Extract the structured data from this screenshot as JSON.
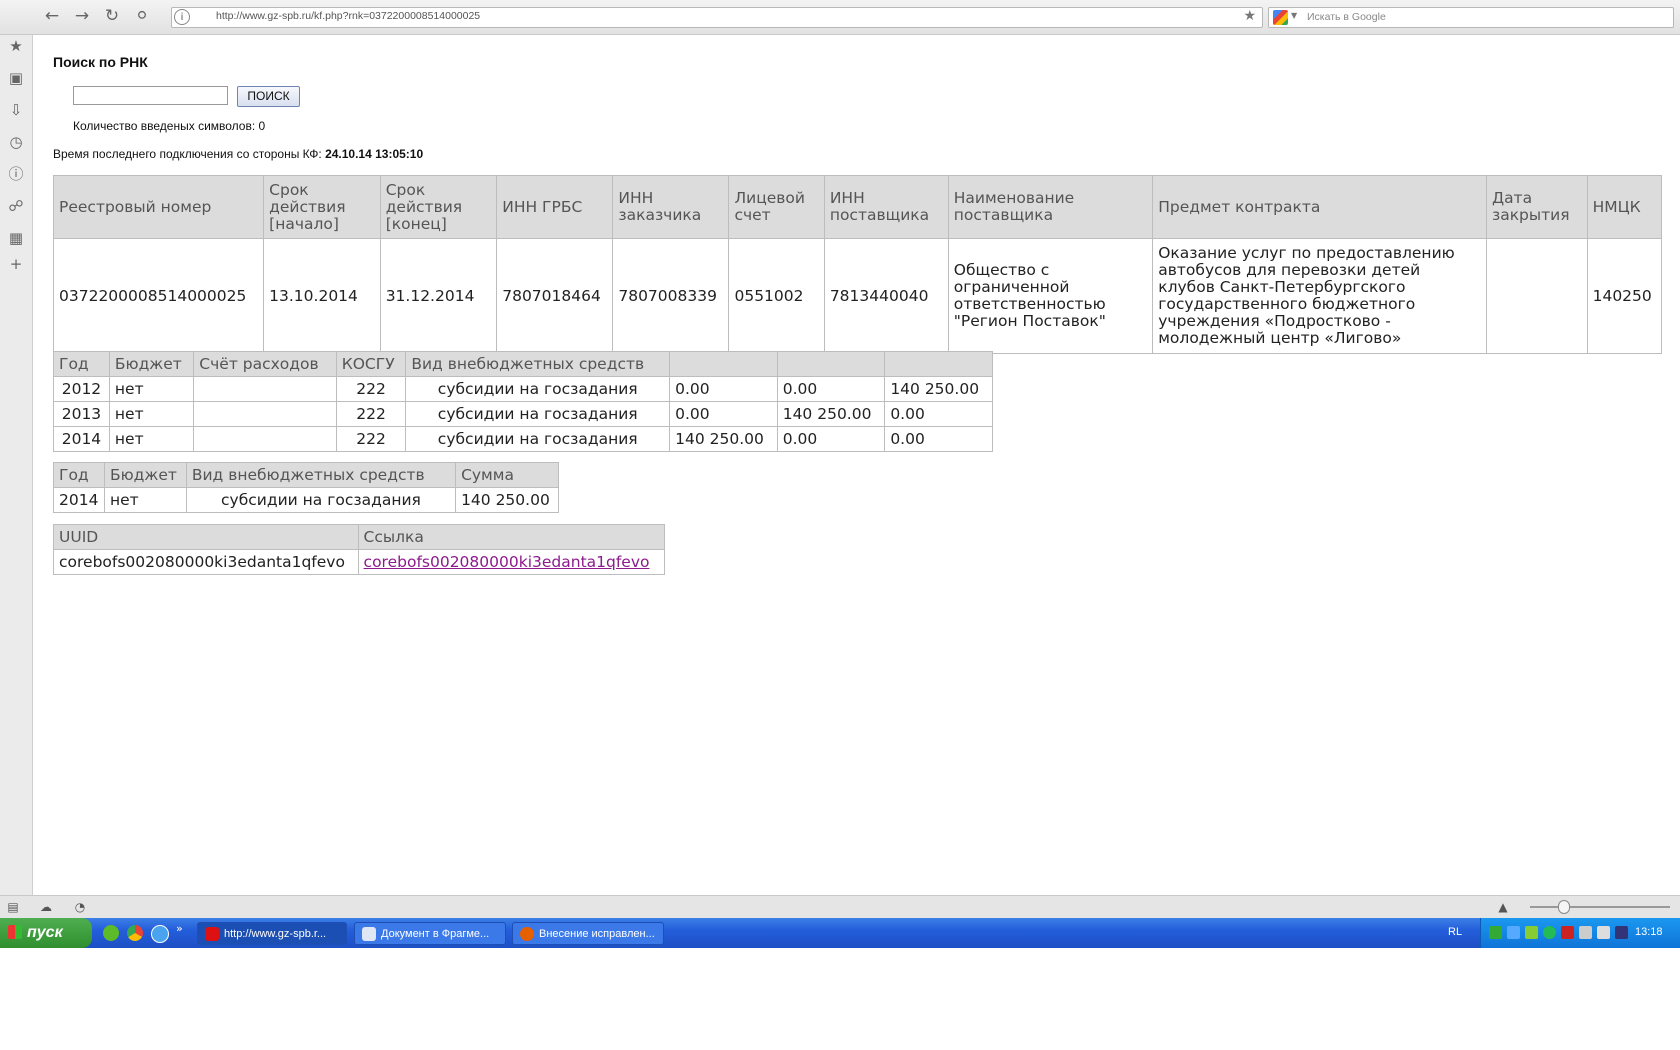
{
  "browser": {
    "address": "http://www.gz-spb.ru/kf.php?rnk=0372200008514000025",
    "search_placeholder": "Искать в Google"
  },
  "page": {
    "title": "Поиск по РНК",
    "search_input_value": "",
    "search_button": "ПОИСК",
    "char_count_label": "Количество введеных символов:",
    "char_count_value": "0",
    "last_connection_label": "Время последнего подключения со стороны КФ:",
    "last_connection_value": "24.10.14 13:05:10"
  },
  "main_table": {
    "headers": [
      "Реестровый номер",
      "Срок действия [начало]",
      "Срок действия [конец]",
      "ИНН ГРБС",
      "ИНН заказчика",
      "Лицевой счет",
      "ИНН поставщика",
      "Наименование поставщика",
      "Предмет контракта",
      "Дата закрытия",
      "НМЦК"
    ],
    "row": [
      "0372200008514000025",
      "13.10.2014",
      "31.12.2014",
      "7807018464",
      "7807008339",
      "0551002",
      "7813440040",
      "Общество с ограниченной ответственностью \"Регион Поставок\"",
      "Оказание услуг по предоставлению автобусов для перевозки детей клубов Санкт-Петербургского государственного бюджетного учреждения «Подростково - молодежный центр «Лигово»",
      "",
      "140250"
    ]
  },
  "finance_table": {
    "headers": [
      "Год",
      "Бюджет",
      "Счёт расходов",
      "КОСГУ",
      "Вид внебюджетных средств",
      "",
      "",
      ""
    ],
    "rows": [
      [
        "2012",
        "нет",
        "",
        "222",
        "субсидии на госзадания",
        "0.00",
        "0.00",
        "140 250.00"
      ],
      [
        "2013",
        "нет",
        "",
        "222",
        "субсидии на госзадания",
        "0.00",
        "140 250.00",
        "0.00"
      ],
      [
        "2014",
        "нет",
        "",
        "222",
        "субсидии на госзадания",
        "140 250.00",
        "0.00",
        "0.00"
      ]
    ]
  },
  "sum_table": {
    "headers": [
      "Год",
      "Бюджет",
      "Вид внебюджетных средств",
      "Сумма"
    ],
    "rows": [
      [
        "2014",
        "нет",
        "субсидии на госзадания",
        "140 250.00"
      ]
    ]
  },
  "link_table": {
    "headers": [
      "UUID",
      "Ссылка"
    ],
    "rows": [
      [
        "corebofs002080000ki3edanta1qfevo",
        "corebofs002080000ki3edanta1qfevo"
      ]
    ]
  },
  "taskbar": {
    "start": "пуск",
    "tasks": [
      "http://www.gz-spb.r...",
      "Документ в Фрагме...",
      "Внесение исправлен..."
    ],
    "lang": "RL",
    "clock": "13:18"
  }
}
